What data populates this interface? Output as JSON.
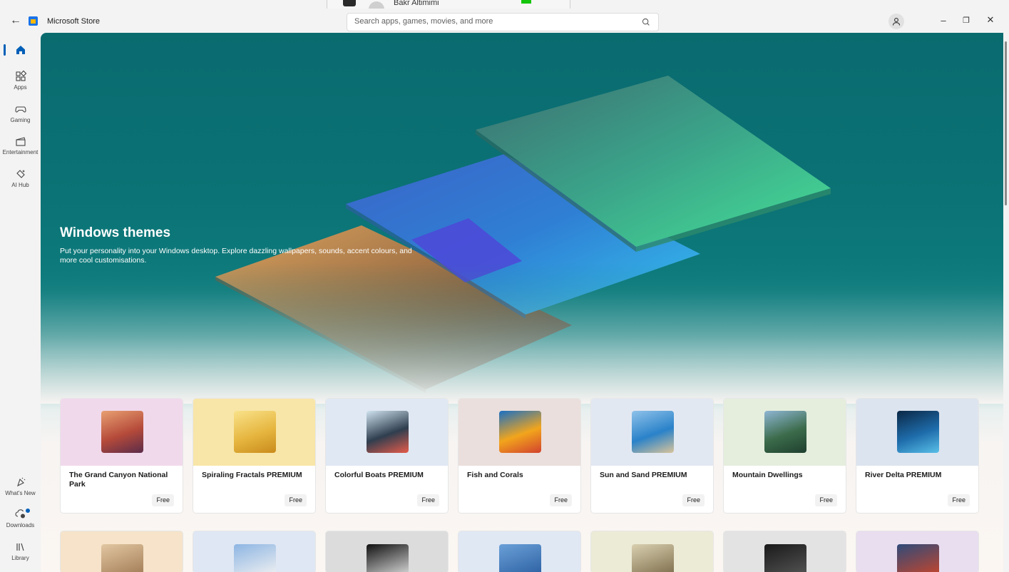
{
  "peek": {
    "user": "Bakr Altimimi"
  },
  "app": {
    "title": "Microsoft Store",
    "back_label": "←"
  },
  "search": {
    "placeholder": "Search apps, games, movies, and more"
  },
  "window": {
    "minimize": "–",
    "restore": "❐",
    "close": "✕"
  },
  "sidebar": {
    "items": [
      {
        "label": "",
        "icon": "home-icon",
        "active": true
      },
      {
        "label": "Apps",
        "icon": "apps-icon"
      },
      {
        "label": "Gaming",
        "icon": "gamepad-icon"
      },
      {
        "label": "Entertainment",
        "icon": "clapperboard-icon"
      },
      {
        "label": "AI Hub",
        "icon": "ai-hub-icon"
      }
    ],
    "bottom": [
      {
        "label": "What's New",
        "icon": "whats-new-icon"
      },
      {
        "label": "Downloads",
        "icon": "downloads-icon"
      },
      {
        "label": "Library",
        "icon": "library-icon"
      }
    ]
  },
  "hero": {
    "title": "Windows themes",
    "description": "Put your personality into your Windows desktop. Explore dazzling wallpapers, sounds, accent colours, and more cool customisations."
  },
  "cards": [
    {
      "name": "The Grand Canyon National Park",
      "price": "Free",
      "bg": "#f1d9ec",
      "thumb": [
        "#e8a071",
        "#b54a3a",
        "#5b2c49"
      ]
    },
    {
      "name": "Spiraling Fractals PREMIUM",
      "price": "Free",
      "bg": "#f8e6a8",
      "thumb": [
        "#f9e28a",
        "#e6b640",
        "#c98b1c"
      ]
    },
    {
      "name": "Colorful Boats PREMIUM",
      "price": "Free",
      "bg": "#dfe8f3",
      "thumb": [
        "#cfe2ef",
        "#2f3e4f",
        "#e65b4a"
      ]
    },
    {
      "name": "Fish and Corals",
      "price": "Free",
      "bg": "#eadfdc",
      "thumb": [
        "#1a6fc4",
        "#f2a51c",
        "#d2422e"
      ]
    },
    {
      "name": "Sun and Sand PREMIUM",
      "price": "Free",
      "bg": "#e2e8f2",
      "thumb": [
        "#8fc2ea",
        "#2a82c9",
        "#d9c49a"
      ]
    },
    {
      "name": "Mountain Dwellings",
      "price": "Free",
      "bg": "#e5eedd",
      "thumb": [
        "#8fb6d4",
        "#3b6b4a",
        "#1f3f2f"
      ]
    },
    {
      "name": "River Delta PREMIUM",
      "price": "Free",
      "bg": "#dce4ef",
      "thumb": [
        "#0b2846",
        "#1e6cab",
        "#59c0e8"
      ]
    }
  ],
  "cards_row2": [
    {
      "bg": "#f6e3c9",
      "thumb": [
        "#e2c7a2",
        "#a07a54"
      ]
    },
    {
      "bg": "#dfe7f4",
      "thumb": [
        "#8db5e3",
        "#f1f1f1"
      ]
    },
    {
      "bg": "#dcdcdc",
      "thumb": [
        "#111111",
        "#dddddd"
      ]
    },
    {
      "bg": "#e0e8f4",
      "thumb": [
        "#6aa0d8",
        "#2b5fa1"
      ]
    },
    {
      "bg": "#ecebd6",
      "thumb": [
        "#d9d0b0",
        "#7b6b4a"
      ]
    },
    {
      "bg": "#e3e3e3",
      "thumb": [
        "#1a1a1a",
        "#555555"
      ]
    },
    {
      "bg": "#e9def0",
      "thumb": [
        "#2f4b7a",
        "#c8452a"
      ]
    }
  ]
}
